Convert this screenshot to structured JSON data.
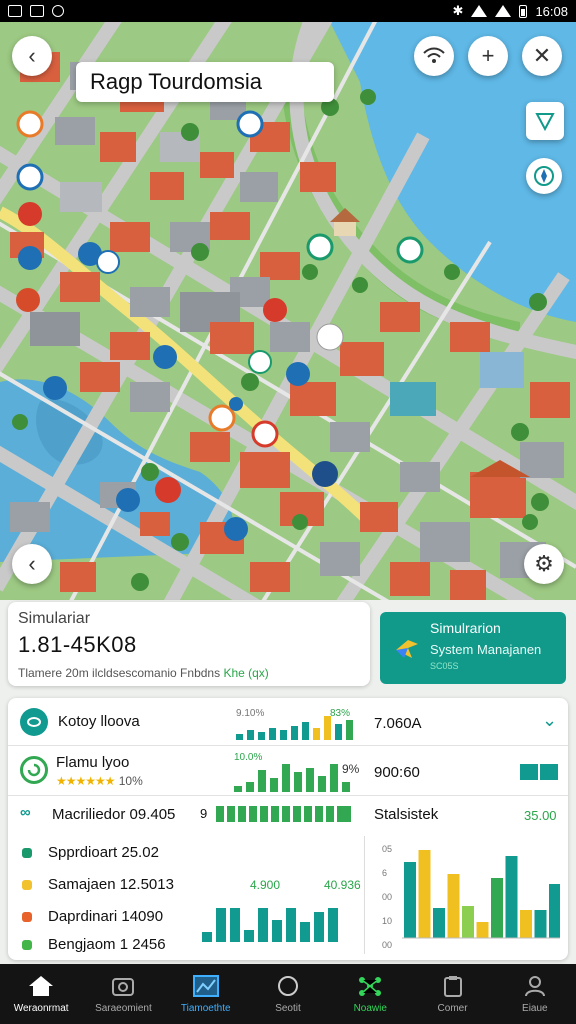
{
  "status_bar": {
    "time": "16:08"
  },
  "map": {
    "title": "Ragp Tourdomsia"
  },
  "summary": {
    "label": "Simulariar",
    "value": "1.81-45K08",
    "subtitle": "Tlamere 20m ilcldsescomanio Fnbdns",
    "subtitle_highlight": "Khe (qx)"
  },
  "sim_card": {
    "title": "Simulrarion",
    "subtitle": "System Manajanen",
    "tag": "SC05S"
  },
  "stats": {
    "rows": [
      {
        "label": "Kotoy lloova",
        "pct_left": "9.10%",
        "pct_right": "83%",
        "value": "7.060A",
        "icon": "globe-icon"
      },
      {
        "label": "Flamu lyoo",
        "stars": "★★★★★★",
        "rating": "10%",
        "pct_left": "10.0%",
        "pct_right": "9%",
        "value": "900:60",
        "icon": "refresh-icon"
      },
      {
        "label": "Macriliedor 09.405",
        "prefix": "9",
        "value": "Stalsistek",
        "right_value": "35.00",
        "icon": "link-icon"
      }
    ],
    "legend": [
      {
        "label": "Spprdioart 25.02",
        "color": "#1a9a6c"
      },
      {
        "label": "Samajaen 12.5013",
        "color": "#f2c12e"
      },
      {
        "label": "Daprdinari 14090",
        "color": "#e8622c"
      },
      {
        "label": "Bengjaom 1 2456",
        "color": "#44b549"
      }
    ],
    "mini_labels": {
      "left": "4.900",
      "right": "40.936"
    },
    "chart_y_ticks": [
      "05",
      "6",
      "00",
      "10",
      "00"
    ],
    "colors": {
      "teal": "#119a8f",
      "green": "#32a852",
      "yellow": "#f0c020",
      "lime": "#8ccf50"
    }
  },
  "bottom_nav": [
    {
      "label": "Weraonrmat",
      "icon": "home-icon"
    },
    {
      "label": "Saraeomient",
      "icon": "camera-icon"
    },
    {
      "label": "Tiamoethte",
      "icon": "map-icon"
    },
    {
      "label": "Seotit",
      "icon": "circle-icon"
    },
    {
      "label": "Noawie",
      "icon": "network-icon"
    },
    {
      "label": "Comer",
      "icon": "clipboard-icon"
    },
    {
      "label": "Eiaue",
      "icon": "person-icon"
    }
  ]
}
